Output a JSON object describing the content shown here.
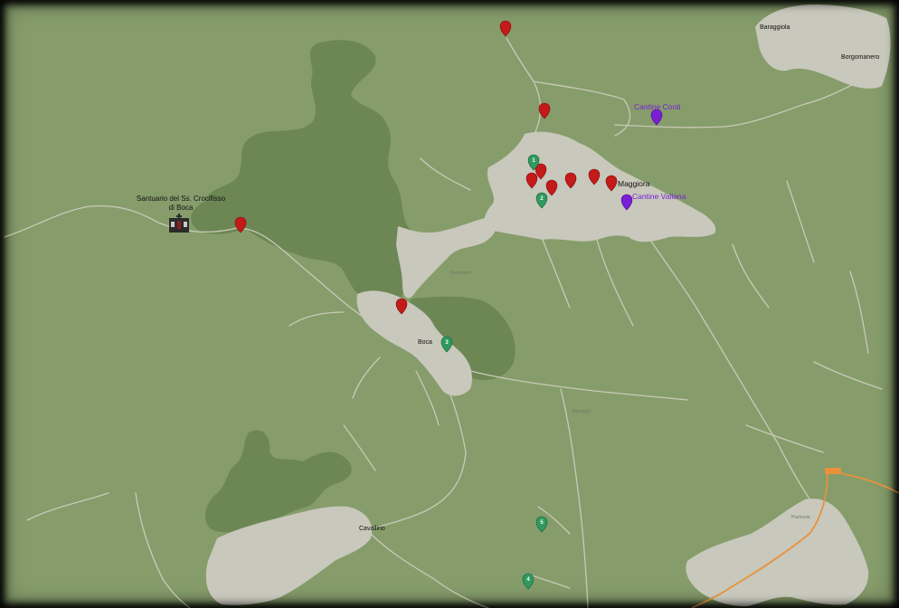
{
  "colors": {
    "background": "#869d6b",
    "forest": "#6c8754",
    "urban": "#c8c8bc",
    "road": "#c9c9b8",
    "marker_red": "#c41a1a",
    "marker_green": "#2f9a5f",
    "marker_violet": "#7a1fd4",
    "highway": "#e8923c"
  },
  "places": {
    "santuario_line1": "Santuario del Ss. Crocifisso",
    "santuario_line2": "di Boca",
    "borgomanero": "Borgomanero",
    "baraggiola": "Baraggiola",
    "maggiora": "Maggiora",
    "boca": "Boca",
    "ronchetto": "Ronchetto",
    "cavallirio": "Cavallirio",
    "baraggia": "Baraggia",
    "piumosia": "Piumosia"
  },
  "wineries": {
    "conti": "Cantine Conti",
    "vallana": "Cantine Vallana"
  },
  "markers": {
    "red_icon": "map-pin-red",
    "green_icon": "map-pin-green",
    "violet_icon": "map-pin-violet",
    "church_icon": "church-icon",
    "green_numbers": [
      "1",
      "2",
      "3",
      "4",
      "5"
    ]
  }
}
